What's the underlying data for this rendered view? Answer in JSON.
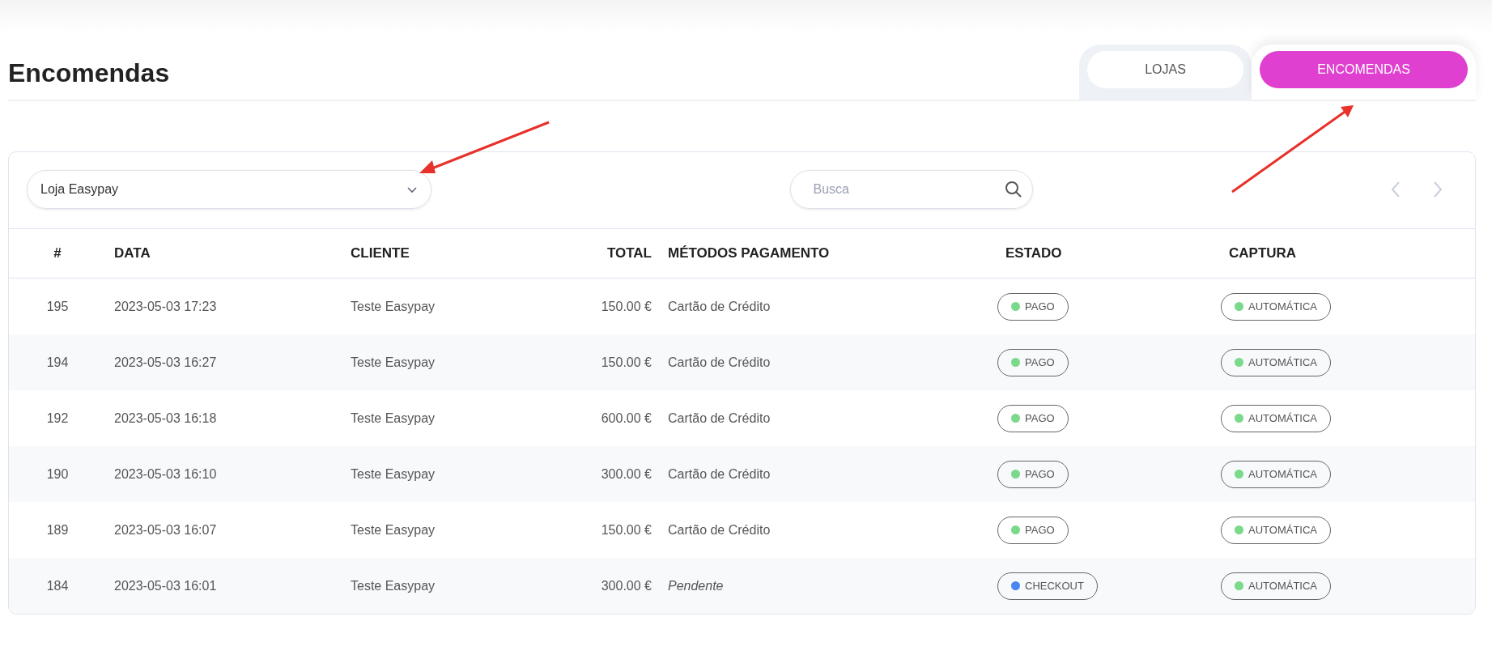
{
  "title": "Encomendas",
  "tabs": [
    {
      "label": "LOJAS",
      "selected": false
    },
    {
      "label": "ENCOMENDAS",
      "selected": true
    }
  ],
  "toolbar": {
    "store_select": {
      "value": "Loja Easypay"
    },
    "search": {
      "placeholder": "Busca"
    }
  },
  "table": {
    "columns": [
      "#",
      "DATA",
      "CLIENTE",
      "TOTAL",
      "MÉTODOS PAGAMENTO",
      "ESTADO",
      "CAPTURA"
    ],
    "rows": [
      {
        "id": "195",
        "date": "2023-05-03 17:23",
        "client": "Teste Easypay",
        "total": "150.00 €",
        "method": {
          "kind": "method",
          "text": "Cartão de Crédito"
        },
        "status": {
          "label": "PAGO",
          "color": "#7ad98a"
        },
        "capture": {
          "label": "AUTOMÁTICA",
          "color": "#7ad98a"
        }
      },
      {
        "id": "194",
        "date": "2023-05-03 16:27",
        "client": "Teste Easypay",
        "total": "150.00 €",
        "method": {
          "kind": "method",
          "text": "Cartão de Crédito"
        },
        "status": {
          "label": "PAGO",
          "color": "#7ad98a"
        },
        "capture": {
          "label": "AUTOMÁTICA",
          "color": "#7ad98a"
        }
      },
      {
        "id": "192",
        "date": "2023-05-03 16:18",
        "client": "Teste Easypay",
        "total": "600.00 €",
        "method": {
          "kind": "method",
          "text": "Cartão de Crédito"
        },
        "status": {
          "label": "PAGO",
          "color": "#7ad98a"
        },
        "capture": {
          "label": "AUTOMÁTICA",
          "color": "#7ad98a"
        }
      },
      {
        "id": "190",
        "date": "2023-05-03 16:10",
        "client": "Teste Easypay",
        "total": "300.00 €",
        "method": {
          "kind": "method",
          "text": "Cartão de Crédito"
        },
        "status": {
          "label": "PAGO",
          "color": "#7ad98a"
        },
        "capture": {
          "label": "AUTOMÁTICA",
          "color": "#7ad98a"
        }
      },
      {
        "id": "189",
        "date": "2023-05-03 16:07",
        "client": "Teste Easypay",
        "total": "150.00 €",
        "method": {
          "kind": "method",
          "text": "Cartão de Crédito"
        },
        "status": {
          "label": "PAGO",
          "color": "#7ad98a"
        },
        "capture": {
          "label": "AUTOMÁTICA",
          "color": "#7ad98a"
        }
      },
      {
        "id": "184",
        "date": "2023-05-03 16:01",
        "client": "Teste Easypay",
        "total": "300.00 €",
        "method": {
          "kind": "pending",
          "text": "Pendente"
        },
        "status": {
          "label": "CHECKOUT",
          "color": "#4a86f0"
        },
        "capture": {
          "label": "AUTOMÁTICA",
          "color": "#7ad98a"
        }
      }
    ]
  }
}
